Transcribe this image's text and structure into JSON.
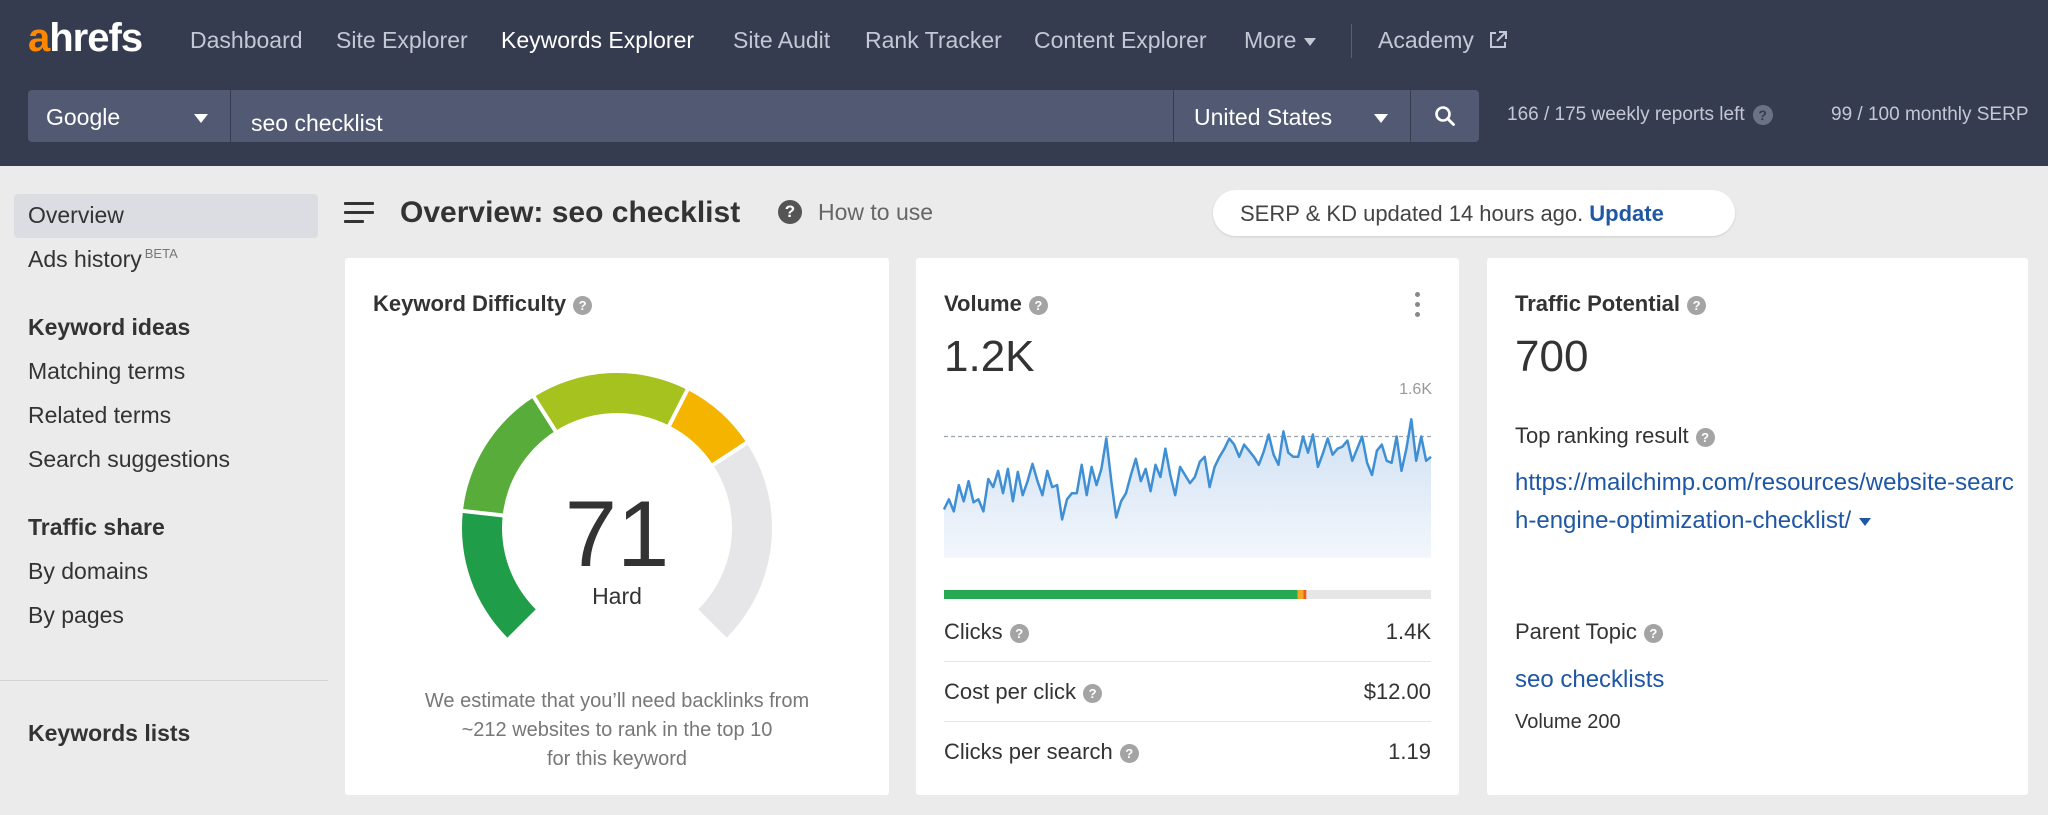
{
  "app": {
    "logo_accent": "a",
    "logo_rest": "hrefs",
    "colors": {
      "nav_bg": "#363c50",
      "logo_accent": "#ff8800",
      "link": "#1f57a4",
      "kd_hard": "#f5b400"
    }
  },
  "nav": {
    "items": [
      {
        "label": "Dashboard",
        "active": false
      },
      {
        "label": "Site Explorer",
        "active": false
      },
      {
        "label": "Keywords Explorer",
        "active": true
      },
      {
        "label": "Site Audit",
        "active": false
      },
      {
        "label": "Rank Tracker",
        "active": false
      },
      {
        "label": "Content Explorer",
        "active": false
      },
      {
        "label": "More",
        "active": false
      }
    ],
    "academy": "Academy",
    "academy_icon": "external-link-icon"
  },
  "search": {
    "engine": "Google",
    "query": "seo checklist",
    "country": "United States",
    "search_icon": "search-icon",
    "weekly_reports": "166 / 175 weekly reports left",
    "monthly_serp": "99 / 100 monthly SERP"
  },
  "sidebar": {
    "overview": "Overview",
    "ads_history": "Ads history",
    "ads_badge": "BETA",
    "keyword_ideas": "Keyword ideas",
    "matching_terms": "Matching terms",
    "related_terms": "Related terms",
    "search_suggestions": "Search suggestions",
    "traffic_share": "Traffic share",
    "by_domains": "By domains",
    "by_pages": "By pages",
    "keywords_lists": "Keywords lists"
  },
  "header": {
    "title": "Overview: seo checklist",
    "how_to_use": "How to use",
    "status_text": "SERP & KD updated 14 hours ago.",
    "update_link": "Update"
  },
  "kd": {
    "title": "Keyword Difficulty",
    "score": 71,
    "score_text": "71",
    "label": "Hard",
    "desc_line1": "We estimate that you’ll need backlinks from",
    "desc_line2": "~212 websites to rank in the top 10",
    "desc_line3": "for this keyword"
  },
  "volume": {
    "title": "Volume",
    "value": "1.2K",
    "chart_max_label": "1.6K",
    "chart_values": [
      480,
      580,
      460,
      720,
      560,
      760,
      550,
      580,
      460,
      780,
      700,
      860,
      640,
      880,
      560,
      850,
      620,
      760,
      930,
      760,
      620,
      860,
      700,
      720,
      380,
      580,
      640,
      640,
      920,
      620,
      900,
      720,
      880,
      1180,
      760,
      400,
      560,
      640,
      820,
      980,
      760,
      880,
      660,
      920,
      800,
      1080,
      820,
      620,
      900,
      820,
      740,
      800,
      950,
      1000,
      700,
      900,
      1000,
      1080,
      1180,
      1120,
      1000,
      1120,
      1060,
      1000,
      920,
      1050,
      1220,
      1020,
      920,
      1250,
      1040,
      1000,
      1000,
      1200,
      1040,
      1220,
      900,
      1030,
      1180,
      1020,
      1080,
      1100,
      1160,
      960,
      1080,
      1200,
      940,
      820,
      1060,
      1120,
      960,
      940,
      1200,
      860,
      1080,
      1370,
      960,
      1200,
      960,
      1000
    ],
    "dashed_reference": 1200,
    "clicks_share": {
      "organic_pct": 72.6,
      "paid_pct": 1.2,
      "other_pct": 0.6,
      "colors": [
        "#27a852",
        "#f5a623",
        "#e85d27"
      ]
    },
    "clicks_label": "Clicks",
    "clicks_value": "1.4K",
    "cpc_label": "Cost per click",
    "cpc_value": "$12.00",
    "cps_label": "Clicks per search",
    "cps_value": "1.19"
  },
  "traffic": {
    "title": "Traffic Potential",
    "value": "700",
    "top_result_label": "Top ranking result",
    "top_result_url": "https://mailchimp.com/resources/website-search-engine-optimization-checklist/",
    "parent_label": "Parent Topic",
    "parent_link": "seo checklists",
    "parent_volume": "Volume 200"
  }
}
